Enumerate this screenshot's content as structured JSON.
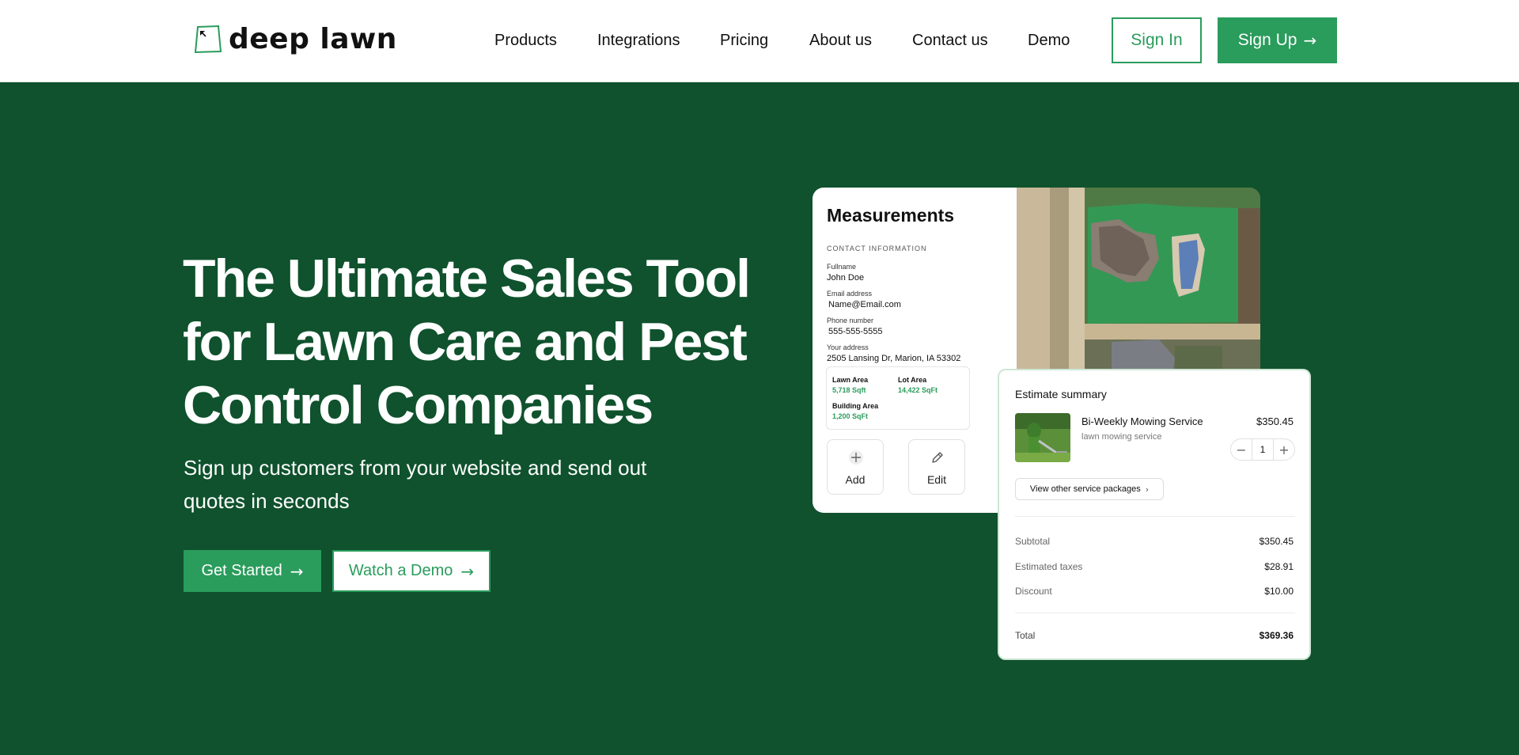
{
  "brand": {
    "name": "deep lawn",
    "logo_icon": "lawn-polygon-icon"
  },
  "nav": {
    "items": [
      "Products",
      "Integrations",
      "Pricing",
      "About us",
      "Contact us",
      "Demo"
    ],
    "sign_in": "Sign In",
    "sign_up": "Sign Up",
    "arrow": "→"
  },
  "hero": {
    "title_lines": [
      "The Ultimate Sales Tool",
      "for Lawn Care and Pest",
      "Control Companies"
    ],
    "subtitle_lines": [
      "Sign up customers from your website and send out",
      "quotes in seconds"
    ],
    "get_started": "Get Started",
    "watch_demo": "Watch a Demo",
    "arrow": "→"
  },
  "measurements": {
    "title": "Measurements",
    "contact_header": "CONTACT INFORMATION",
    "fullname_label": "Fullname",
    "fullname": "John Doe",
    "email_label": "Email address",
    "email": "Name@Email.com",
    "phone_label": "Phone number",
    "phone": "555-555-5555",
    "address_label": "Your address",
    "address": "2505 Lansing Dr, Marion, IA 53302",
    "lawn_area_label": "Lawn Area",
    "lawn_area": "5,718 Sqft",
    "lot_area_label": "Lot Area",
    "lot_area": "14,422 SqFt",
    "building_area_label": "Building Area",
    "building_area": "1,200 SqFt",
    "add_label": "Add",
    "edit_label": "Edit"
  },
  "estimate": {
    "title": "Estimate summary",
    "service_name": "Bi-Weekly Mowing Service",
    "service_desc": "lawn mowing service",
    "service_price": "$350.45",
    "quantity": "1",
    "minus": "−",
    "plus": "+",
    "packages_button": "View other service packages",
    "chevron": "›",
    "subtotal_label": "Subtotal",
    "subtotal": "$350.45",
    "taxes_label": "Estimated taxes",
    "taxes": "$28.91",
    "discount_label": "Discount",
    "discount": "$10.00",
    "total_label": "Total",
    "total": "$369.36"
  },
  "colors": {
    "brand_green": "#2a9c5c",
    "hero_bg": "#0f522d"
  }
}
